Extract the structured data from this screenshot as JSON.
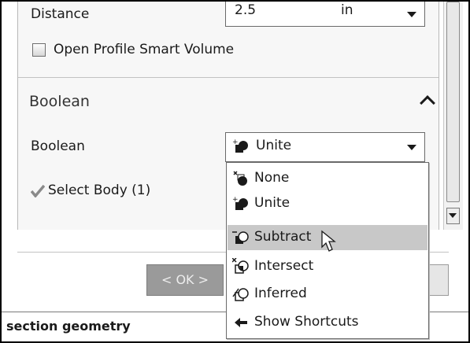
{
  "distance": {
    "label": "Distance",
    "value": "2.5",
    "unit": "in"
  },
  "open_profile": {
    "label": "Open Profile Smart Volume",
    "checked": false
  },
  "boolean_section": {
    "title": "Boolean"
  },
  "boolean_field": {
    "label": "Boolean",
    "selected_value": "Unite"
  },
  "select_body": {
    "label": "Select Body (1)"
  },
  "dropdown": {
    "items": [
      {
        "label": "None",
        "icon": "boolean-none-icon"
      },
      {
        "label": "Unite",
        "icon": "boolean-unite-icon"
      },
      {
        "label": "Subtract",
        "icon": "boolean-subtract-icon",
        "selected": true
      },
      {
        "label": "Intersect",
        "icon": "boolean-intersect-icon"
      },
      {
        "label": "Inferred",
        "icon": "boolean-inferred-icon"
      },
      {
        "label": "Show Shortcuts",
        "icon": "show-shortcuts-icon"
      }
    ]
  },
  "buttons": {
    "ok_label": "< OK >"
  },
  "status_bar": {
    "text": "section geometry"
  },
  "colors": {
    "panel_bg": "#f7f7f7",
    "selected_item": "#c8c8c8",
    "ok_button": "#9a9a9a",
    "checkmark": "#8a8a8a"
  }
}
